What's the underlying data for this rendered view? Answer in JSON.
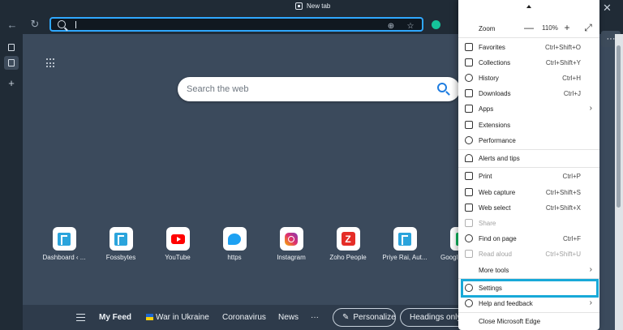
{
  "browser": {
    "tab_title": "New tab",
    "address_placeholder": ""
  },
  "newtab": {
    "search_placeholder": "Search the web",
    "quick_links": [
      {
        "label": "Dashboard ‹ ...",
        "icon": "fossbytes-icon"
      },
      {
        "label": "Fossbytes",
        "icon": "fossbytes-icon"
      },
      {
        "label": "YouTube",
        "icon": "youtube-icon"
      },
      {
        "label": "https",
        "icon": "twitter-icon"
      },
      {
        "label": "Instagram",
        "icon": "instagram-icon"
      },
      {
        "label": "Zoho People",
        "icon": "zoho-icon"
      },
      {
        "label": "Priye Rai, Aut...",
        "icon": "fossbytes-icon"
      },
      {
        "label": "Googl",
        "icon": "google-icon"
      }
    ],
    "feed": {
      "my_feed": "My Feed",
      "items": [
        "War in Ukraine",
        "Coronavirus",
        "News"
      ],
      "more": "···",
      "personalize": "Personalize",
      "headings_only": "Headings only"
    }
  },
  "menu": {
    "zoom_label": "Zoom",
    "zoom_minus": "—",
    "zoom_value": "110%",
    "zoom_plus": "+",
    "items": [
      {
        "label": "Favorites",
        "shortcut": "Ctrl+Shift+O"
      },
      {
        "label": "Collections",
        "shortcut": "Ctrl+Shift+Y"
      },
      {
        "label": "History",
        "shortcut": "Ctrl+H"
      },
      {
        "label": "Downloads",
        "shortcut": "Ctrl+J"
      },
      {
        "label": "Apps",
        "shortcut": "›"
      },
      {
        "label": "Extensions",
        "shortcut": ""
      },
      {
        "label": "Performance",
        "shortcut": ""
      },
      {
        "label": "Alerts and tips",
        "shortcut": ""
      },
      {
        "label": "Print",
        "shortcut": "Ctrl+P"
      },
      {
        "label": "Web capture",
        "shortcut": "Ctrl+Shift+S"
      },
      {
        "label": "Web select",
        "shortcut": "Ctrl+Shift+X"
      },
      {
        "label": "Share",
        "shortcut": ""
      },
      {
        "label": "Find on page",
        "shortcut": "Ctrl+F"
      },
      {
        "label": "Read aloud",
        "shortcut": "Ctrl+Shift+U"
      },
      {
        "label": "More tools",
        "shortcut": "›"
      },
      {
        "label": "Settings",
        "shortcut": ""
      },
      {
        "label": "Help and feedback",
        "shortcut": "›"
      },
      {
        "label": "Close Microsoft Edge",
        "shortcut": ""
      }
    ]
  },
  "colors": {
    "accent": "#18a9d8",
    "address_focus": "#2fa8ff",
    "page_bg": "#3b4a5c"
  }
}
